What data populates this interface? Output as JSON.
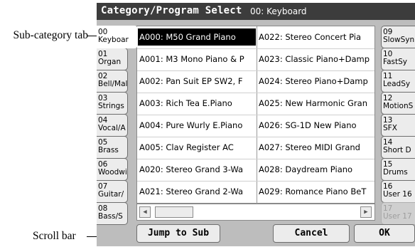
{
  "annotations": {
    "subcategory_tab": "Sub-category tab",
    "scroll_bar": "Scroll bar"
  },
  "window": {
    "title": "Category/Program Select",
    "subtitle": "00: Keyboard"
  },
  "left_tabs": [
    {
      "num": "00",
      "name": "Keyboar"
    },
    {
      "num": "01",
      "name": "Organ"
    },
    {
      "num": "02",
      "name": "Bell/Mal"
    },
    {
      "num": "03",
      "name": "Strings"
    },
    {
      "num": "04",
      "name": "Vocal/A"
    },
    {
      "num": "05",
      "name": "Brass"
    },
    {
      "num": "06",
      "name": "Woodwi"
    },
    {
      "num": "07",
      "name": "Guitar/"
    },
    {
      "num": "08",
      "name": "Bass/S"
    }
  ],
  "right_tabs": [
    {
      "num": "09",
      "name": "SlowSyn"
    },
    {
      "num": "10",
      "name": "FastSy"
    },
    {
      "num": "11",
      "name": "LeadSy"
    },
    {
      "num": "12",
      "name": "MotionS"
    },
    {
      "num": "13",
      "name": "SFX"
    },
    {
      "num": "14",
      "name": "Short D"
    },
    {
      "num": "15",
      "name": "Drums"
    },
    {
      "num": "16",
      "name": "User 16"
    },
    {
      "num": "17",
      "name": "User 17"
    }
  ],
  "programs_left": [
    "A000: M50 Grand Piano",
    "A001: M3 Mono Piano & P",
    "A002: Pan Suit EP SW2, F",
    "A003: Rich Tea E.Piano",
    "A004: Pure Wurly E.Piano",
    "A005: Clav Register AC",
    "A020: Stereo Grand 3-Wa",
    "A021: Stereo Grand 2-Wa"
  ],
  "programs_right": [
    "A022: Stereo Concert Pia",
    "A023: Classic Piano+Damp",
    "A024: Stereo Piano+Damp",
    "A025: New Harmonic Gran",
    "A026: SG-1D New Piano",
    "A027: Stereo MIDI Grand",
    "A028: Daydream Piano",
    "A029: Romance Piano BeT"
  ],
  "buttons": {
    "jump_to_sub": "Jump to Sub",
    "cancel": "Cancel",
    "ok": "OK"
  },
  "scrollbar": {
    "left_arrow_icon": "triangle-left-icon",
    "right_arrow_icon": "triangle-right-icon"
  },
  "colors": {
    "title_bar": "#3c3c3c",
    "screen_bg": "#bdbdbd",
    "selected_bg": "#000000",
    "selected_fg": "#ffffff"
  }
}
